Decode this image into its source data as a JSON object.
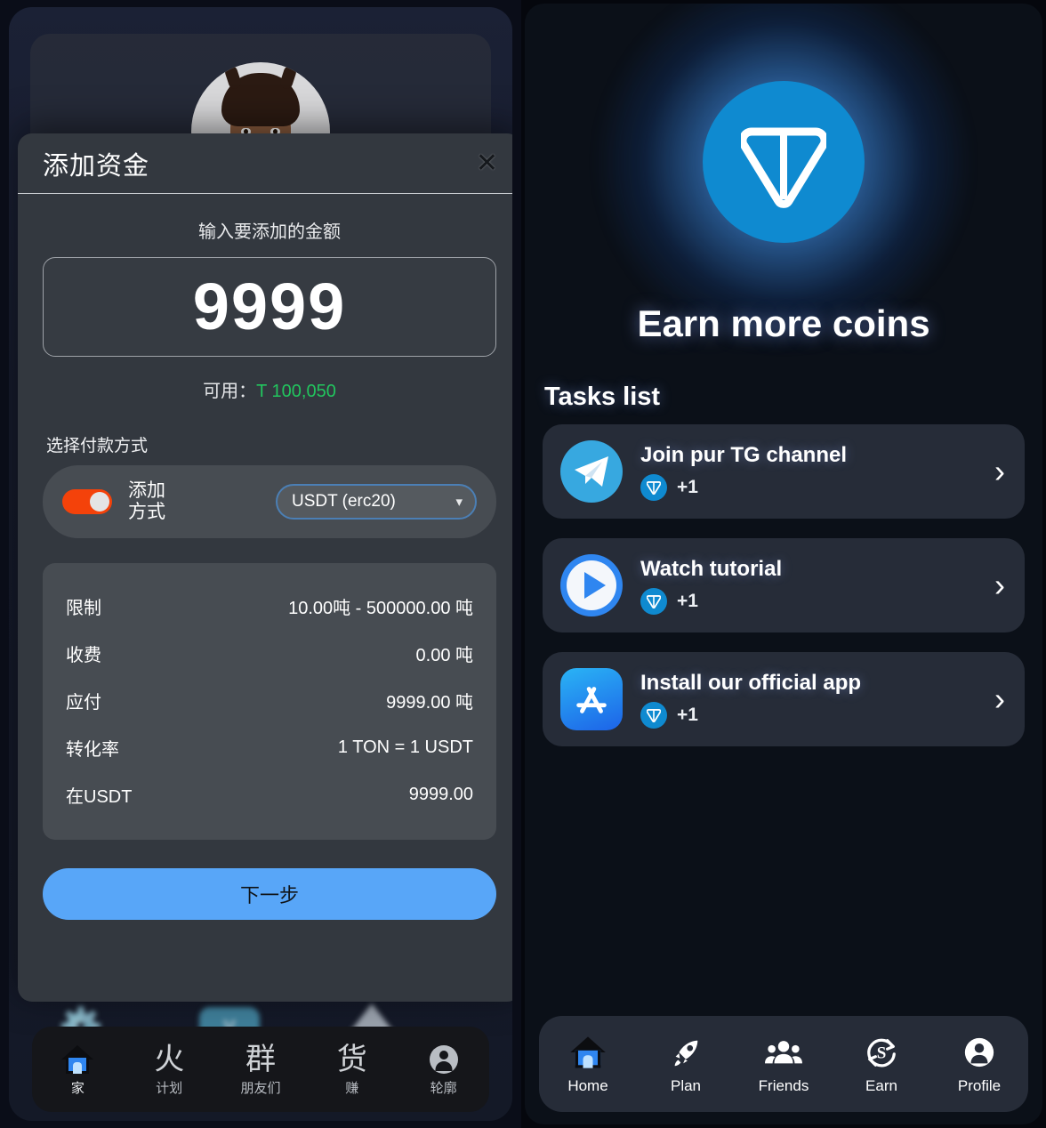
{
  "left_app": {
    "modal": {
      "title": "添加资金",
      "close_icon": "close-icon",
      "amount_label": "输入要添加的金额",
      "amount_value": "9999",
      "available_label": "可用：",
      "available_value": "T 100,050",
      "payment_method_label": "选择付款方式",
      "toggle_text": "添加\n方式",
      "toggle_state": "on",
      "select_value": "USDT (erc20)",
      "details": [
        {
          "key": "限制",
          "value": "10.00吨 - 500000.00 吨"
        },
        {
          "key": "收费",
          "value": "0.00 吨"
        },
        {
          "key": "应付",
          "value": "9999.00 吨"
        },
        {
          "key": "转化率",
          "value": "1 TON = 1 USDT"
        },
        {
          "key": "在USDT",
          "value": "9999.00"
        }
      ],
      "next_button": "下一步"
    },
    "bottom_nav": [
      {
        "icon": "home-icon",
        "label": "家",
        "active": true
      },
      {
        "icon": "火",
        "label": "计划",
        "active": false
      },
      {
        "icon": "群",
        "label": "朋友们",
        "active": false
      },
      {
        "icon": "货",
        "label": "赚",
        "active": false
      },
      {
        "icon": "person-icon",
        "label": "轮廓",
        "active": false
      }
    ]
  },
  "right_app": {
    "hero": {
      "logo_icon": "ton-logo-icon",
      "title": "Earn more coins"
    },
    "tasks_heading": "Tasks list",
    "tasks": [
      {
        "icon": "telegram-icon",
        "title": "Join pur TG channel",
        "reward": "+1",
        "coin_icon": "ton-coin-icon",
        "arrow": "chevron-right-icon"
      },
      {
        "icon": "play-video-icon",
        "title": "Watch tutorial",
        "reward": "+1",
        "coin_icon": "ton-coin-icon",
        "arrow": "chevron-right-icon"
      },
      {
        "icon": "app-store-icon",
        "title": "Install our official app",
        "reward": "+1",
        "coin_icon": "ton-coin-icon",
        "arrow": "chevron-right-icon"
      }
    ],
    "bottom_nav": [
      {
        "icon": "home-icon",
        "label": "Home",
        "active": true
      },
      {
        "icon": "rocket-icon",
        "label": "Plan",
        "active": false
      },
      {
        "icon": "friends-icon",
        "label": "Friends",
        "active": false
      },
      {
        "icon": "earn-icon",
        "label": "Earn",
        "active": false
      },
      {
        "icon": "profile-icon",
        "label": "Profile",
        "active": false
      }
    ]
  },
  "colors": {
    "accent_blue": "#58a6f8",
    "ton_blue": "#0f8ad0",
    "toggle_orange": "#f4420a",
    "available_green": "#22c55e",
    "card_bg": "#262c38",
    "modal_bg": "#33383f"
  }
}
